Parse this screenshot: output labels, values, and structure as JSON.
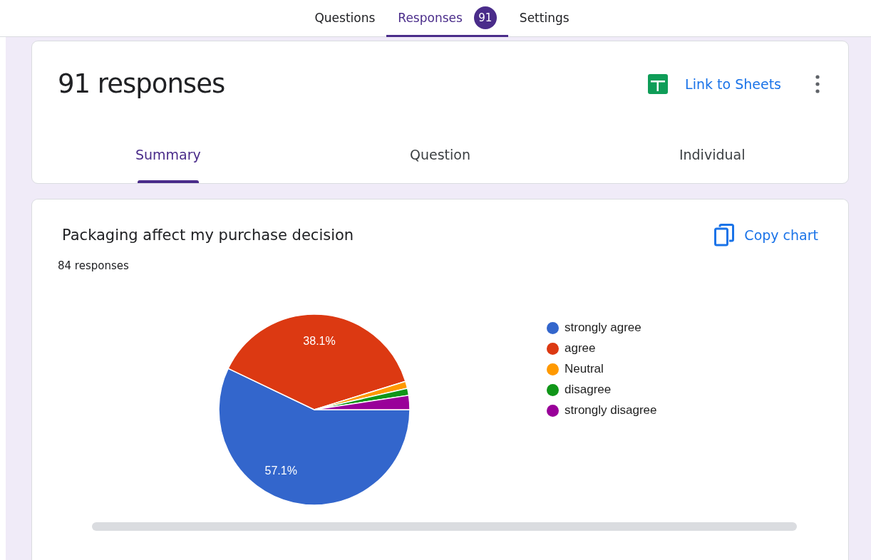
{
  "top_tabs": [
    {
      "label": "Questions",
      "selected": false
    },
    {
      "label": "Responses",
      "selected": true,
      "badge": "91"
    },
    {
      "label": "Settings",
      "selected": false
    }
  ],
  "summary_card": {
    "title": "91 responses",
    "link_label": "Link to Sheets",
    "view_tabs": [
      {
        "label": "Summary",
        "selected": true
      },
      {
        "label": "Question",
        "selected": false
      },
      {
        "label": "Individual",
        "selected": false
      }
    ]
  },
  "question_card": {
    "title": "Packaging affect my purchase decision",
    "copy_label": "Copy chart",
    "response_count": "84 responses",
    "chart_data": {
      "type": "pie",
      "categories": [
        "strongly agree",
        "agree",
        "Neutral",
        "disagree",
        "strongly disagree"
      ],
      "values": [
        57.1,
        38.1,
        1.2,
        1.2,
        2.4
      ],
      "colors": [
        "#3366cc",
        "#dc3912",
        "#ff9900",
        "#109618",
        "#990099"
      ],
      "value_labels": [
        "57.1%",
        "38.1%",
        null,
        null,
        null
      ]
    }
  }
}
